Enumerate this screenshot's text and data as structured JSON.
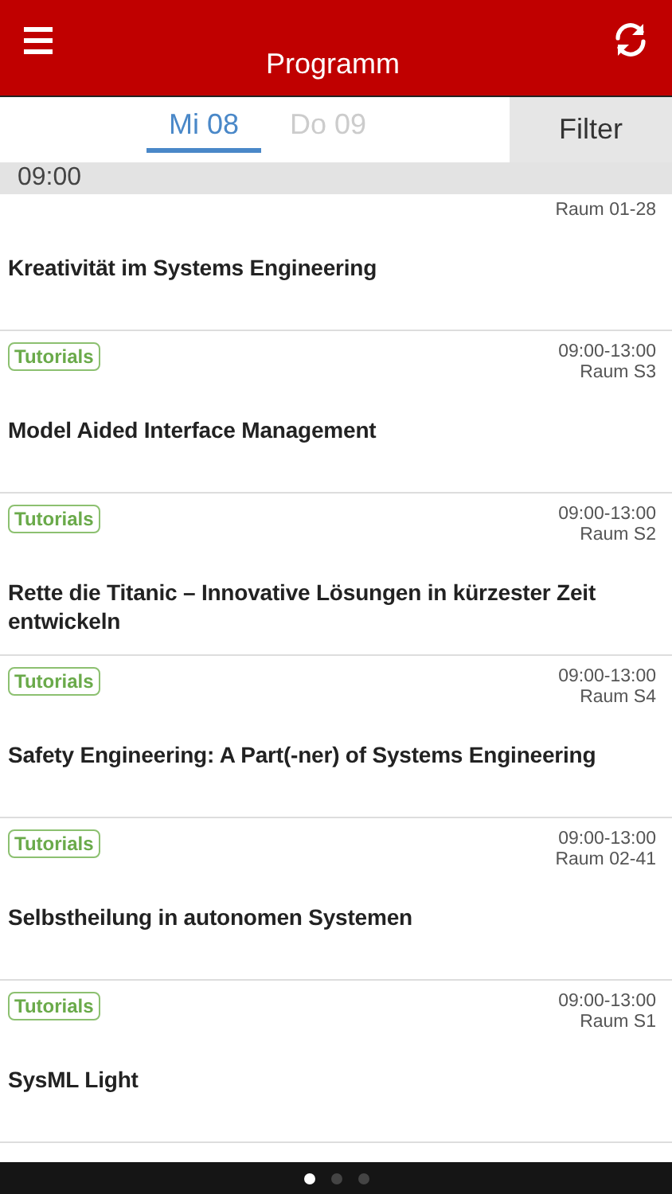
{
  "header": {
    "title": "Programm"
  },
  "days": [
    {
      "label": "Mi 08",
      "selected": true
    },
    {
      "label": "Do 09",
      "selected": false
    }
  ],
  "filter_button": "Filter",
  "time_header": "09:00",
  "sessions": [
    {
      "room": "Raum 01-28",
      "title": "Kreativität im Systems Engineering"
    },
    {
      "tag": "Tutorials",
      "time": "09:00-13:00",
      "room": "Raum S3",
      "title": "Model Aided Interface Management"
    },
    {
      "tag": "Tutorials",
      "time": "09:00-13:00",
      "room": "Raum S2",
      "title": "Rette die Titanic – Innovative Lösungen in kürzester Zeit entwickeln"
    },
    {
      "tag": "Tutorials",
      "time": "09:00-13:00",
      "room": "Raum S4",
      "title": "Safety Engineering: A Part(-ner) of Systems Engineering"
    },
    {
      "tag": "Tutorials",
      "time": "09:00-13:00",
      "room": "Raum 02-41",
      "title": "Selbstheilung in autonomen Systemen"
    },
    {
      "tag": "Tutorials",
      "time": "09:00-13:00",
      "room": "Raum S1",
      "title": "SysML Light"
    }
  ],
  "pager": [
    {
      "selected": true
    },
    {
      "selected": false
    },
    {
      "selected": false
    }
  ]
}
